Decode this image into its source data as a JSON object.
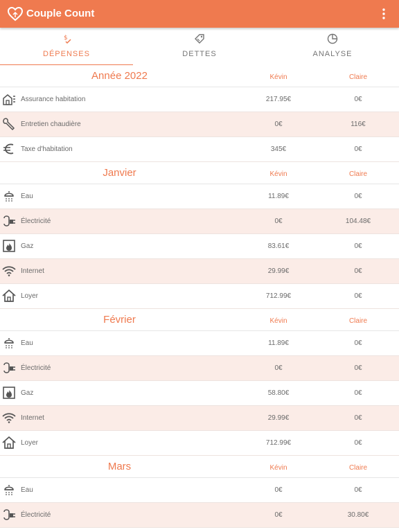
{
  "app": {
    "title": "Couple Count"
  },
  "tabs": [
    {
      "label": "DÉPENSES",
      "icon": "expense-icon",
      "active": true
    },
    {
      "label": "DETTES",
      "icon": "debt-tag-icon",
      "active": false
    },
    {
      "label": "ANALYSE",
      "icon": "pie-chart-icon",
      "active": false
    }
  ],
  "persons": [
    "Kévin",
    "Claire"
  ],
  "sections": [
    {
      "title": "Année 2022",
      "rows": [
        {
          "icon": "house-icon",
          "label": "Assurance habitation",
          "a": "217.95€",
          "b": "0€"
        },
        {
          "icon": "wrench-icon",
          "label": "Entretien chaudière",
          "a": "0€",
          "b": "116€"
        },
        {
          "icon": "euro-icon",
          "label": "Taxe d'habitation",
          "a": "345€",
          "b": "0€"
        }
      ]
    },
    {
      "title": "Janvier",
      "rows": [
        {
          "icon": "water-icon",
          "label": "Eau",
          "a": "11.89€",
          "b": "0€"
        },
        {
          "icon": "plug-icon",
          "label": "Électricité",
          "a": "0€",
          "b": "104.48€"
        },
        {
          "icon": "gas-icon",
          "label": "Gaz",
          "a": "83.61€",
          "b": "0€"
        },
        {
          "icon": "wifi-icon",
          "label": "Internet",
          "a": "29.99€",
          "b": "0€"
        },
        {
          "icon": "home-icon",
          "label": "Loyer",
          "a": "712.99€",
          "b": "0€"
        }
      ]
    },
    {
      "title": "Février",
      "rows": [
        {
          "icon": "water-icon",
          "label": "Eau",
          "a": "11.89€",
          "b": "0€"
        },
        {
          "icon": "plug-icon",
          "label": "Électricité",
          "a": "0€",
          "b": "0€"
        },
        {
          "icon": "gas-icon",
          "label": "Gaz",
          "a": "58.80€",
          "b": "0€"
        },
        {
          "icon": "wifi-icon",
          "label": "Internet",
          "a": "29.99€",
          "b": "0€"
        },
        {
          "icon": "home-icon",
          "label": "Loyer",
          "a": "712.99€",
          "b": "0€"
        }
      ]
    },
    {
      "title": "Mars",
      "rows": [
        {
          "icon": "water-icon",
          "label": "Eau",
          "a": "0€",
          "b": "0€"
        },
        {
          "icon": "plug-icon",
          "label": "Électricité",
          "a": "0€",
          "b": "30.80€"
        }
      ]
    }
  ],
  "colors": {
    "accent": "#ef7a4f",
    "row_alt": "#fbece7"
  }
}
